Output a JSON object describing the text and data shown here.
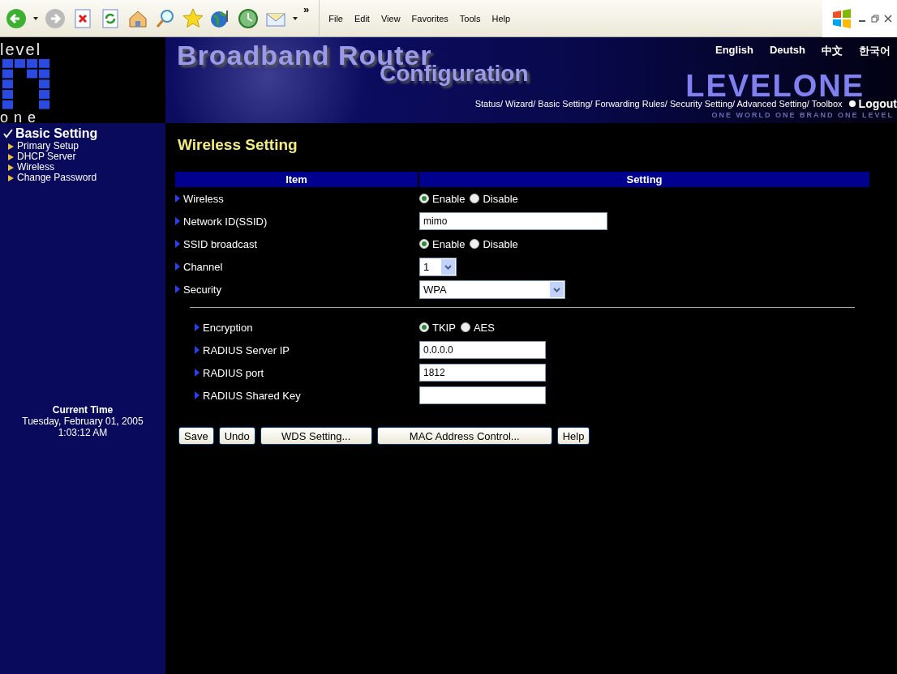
{
  "browser": {
    "chevron": "»",
    "menu": [
      "File",
      "Edit",
      "View",
      "Favorites",
      "Tools",
      "Help"
    ]
  },
  "header": {
    "logo_top": "level",
    "logo_bottom": "one",
    "title": "Broadband Router",
    "subtitle": "Configuration",
    "languages": [
      "English",
      "Deutsh",
      "中文",
      "한국어"
    ],
    "brand": "LEVELONE",
    "nav": "Status/ Wizard/ Basic Setting/ Forwarding Rules/ Security Setting/ Advanced Setting/ Toolbox",
    "logout": "Logout",
    "tagline": "ONE WORLD ONE BRAND ONE LEVEL"
  },
  "sidebar": {
    "section": "Basic Setting",
    "items": [
      "Primary Setup",
      "DHCP Server",
      "Wireless",
      "Change Password"
    ],
    "time_label": "Current Time",
    "date": "Tuesday, February 01, 2005",
    "time": "1:03:12 AM"
  },
  "main": {
    "title": "Wireless Setting",
    "columns": [
      "Item",
      "Setting"
    ],
    "rows": [
      {
        "kind": "radio",
        "label": "Wireless",
        "options": [
          {
            "label": "Enable",
            "selected": true
          },
          {
            "label": "Disable",
            "selected": false
          }
        ]
      },
      {
        "kind": "text",
        "label": "Network ID(SSID)",
        "value": "mimo"
      },
      {
        "kind": "radio",
        "label": "SSID broadcast",
        "options": [
          {
            "label": "Enable",
            "selected": true
          },
          {
            "label": "Disable",
            "selected": false
          }
        ]
      },
      {
        "kind": "select",
        "label": "Channel",
        "value": "1"
      },
      {
        "kind": "select",
        "label": "Security",
        "value": "WPA"
      }
    ],
    "security_rows": [
      {
        "kind": "radio",
        "label": "Encryption",
        "options": [
          {
            "label": "TKIP",
            "selected": true
          },
          {
            "label": "AES",
            "selected": false
          }
        ]
      },
      {
        "kind": "text",
        "label": "RADIUS Server IP",
        "value": "0.0.0.0"
      },
      {
        "kind": "text",
        "label": "RADIUS port",
        "value": "1812"
      },
      {
        "kind": "text",
        "label": "RADIUS Shared Key"
      }
    ],
    "buttons": [
      "Save",
      "Undo",
      "WDS Setting...",
      "MAC Address Control...",
      "Help"
    ]
  }
}
